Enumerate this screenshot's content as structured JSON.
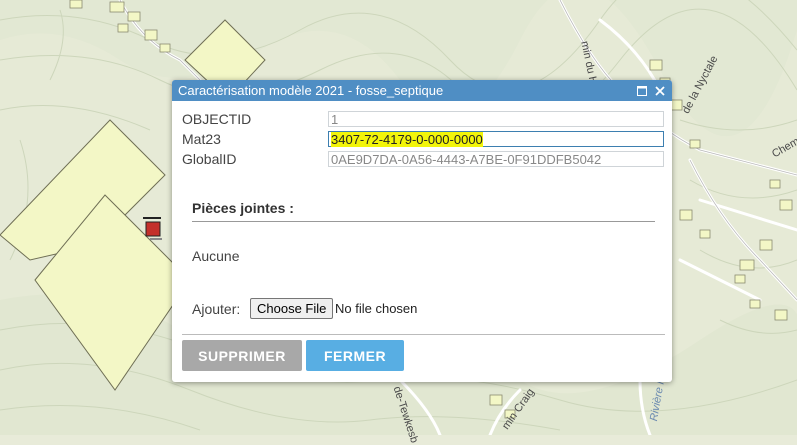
{
  "popup": {
    "title": "Caractérisation modèle 2021 - fosse_septique",
    "maximize_icon": "maximize-icon",
    "close_icon": "close-icon"
  },
  "attributes": [
    {
      "label": "OBJECTID",
      "value": "1"
    },
    {
      "label": "Mat23",
      "value": "3407-72-4179-0-000-0000"
    },
    {
      "label": "GlobalID",
      "value": "0AE9D7DA-0A56-4443-A7BE-0F91DDFB5042"
    }
  ],
  "attachments": {
    "title": "Pièces jointes :",
    "none_text": "Aucune",
    "add_label": "Ajouter:",
    "file_button": "Choose File",
    "file_status": "No file chosen"
  },
  "buttons": {
    "delete": "SUPPRIMER",
    "close": "FERMER"
  },
  "map_labels": {
    "hibou": "min du Hibou",
    "nyctale": "de la Nyctale",
    "cheminee": "Chem",
    "tewkesbury": "de-Tewkesb",
    "craig": "min Craig",
    "riviere": "Rivière H"
  },
  "colors": {
    "header": "#4f8ec4",
    "parcel_fill": "#f3f7c6",
    "highlight": "#f2f50a",
    "close_button": "#58aee3",
    "delete_button": "#a8a8a8"
  }
}
